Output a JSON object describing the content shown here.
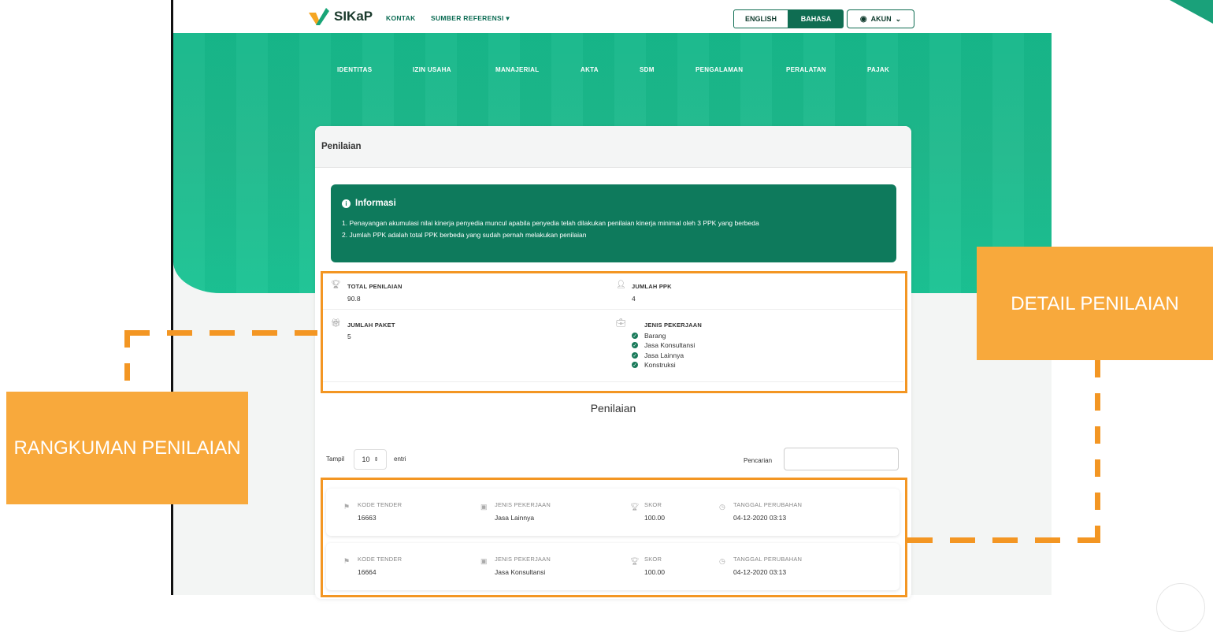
{
  "header": {
    "logo_text": "SIKaP",
    "nav": [
      "KONTAK",
      "SUMBER REFERENSI"
    ],
    "lang_en": "ENGLISH",
    "lang_bahasa": "BAHASA",
    "account": "AKUN"
  },
  "subnav": [
    "IDENTITAS",
    "IZIN USAHA",
    "MANAJERIAL",
    "AKTA",
    "SDM",
    "PENGALAMAN",
    "PERALATAN",
    "PAJAK"
  ],
  "card": {
    "title": "Penilaian",
    "info": {
      "title": "Informasi",
      "lines": [
        "1. Penayangan akumulasi nilai kinerja penyedia muncul apabila penyedia telah dilakukan penilaian kinerja minimal oleh 3 PPK yang berbeda",
        "2. Jumlah PPK adalah total PPK berbeda yang sudah pernah melakukan penilaian"
      ]
    },
    "stats": {
      "total_label": "TOTAL PENILAIAN",
      "total_value": "90.8",
      "ppk_label": "JUMLAH PPK",
      "ppk_value": "4",
      "paket_label": "JUMLAH PAKET",
      "paket_value": "5",
      "jenis_label": "JENIS PEKERJAAN",
      "jenis_items": [
        "Barang",
        "Jasa Konsultansi",
        "Jasa Lainnya",
        "Konstruksi"
      ]
    },
    "section_title": "Penilaian",
    "table_controls": {
      "show_label": "Tampil",
      "show_value": "10",
      "entries_label": "entri",
      "search_label": "Pencarian",
      "search_value": ""
    },
    "rows": [
      {
        "kode_label": "KODE TENDER",
        "kode": "16663",
        "jenis_label": "JENIS PEKERJAAN",
        "jenis": "Jasa Lainnya",
        "skor_label": "SKOR",
        "skor": "100.00",
        "tgl_label": "TANGGAL PERUBAHAN",
        "tgl": "04-12-2020 03:13"
      },
      {
        "kode_label": "KODE TENDER",
        "kode": "16664",
        "jenis_label": "JENIS PEKERJAAN",
        "jenis": "Jasa Konsultansi",
        "skor_label": "SKOR",
        "skor": "100.00",
        "tgl_label": "TANGGAL PERUBAHAN",
        "tgl": "04-12-2020 03:13"
      }
    ]
  },
  "callouts": {
    "left": "RANGKUMAN PENILAIAN",
    "right": "DETAIL PENILAIAN"
  },
  "colors": {
    "brand_green": "#0e7a5c",
    "highlight_orange": "#f39623",
    "callout_orange": "#f8a93c"
  }
}
